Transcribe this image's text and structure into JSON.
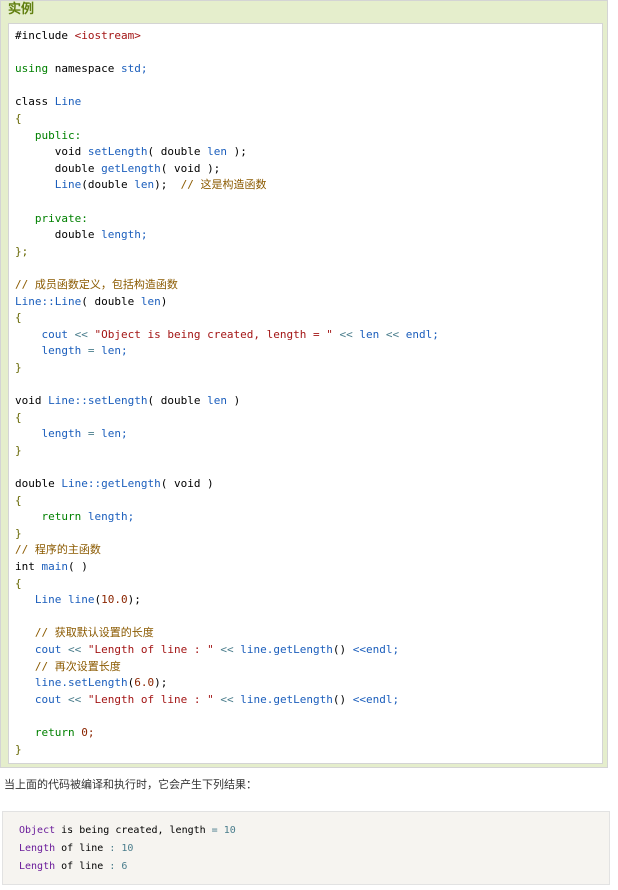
{
  "example": {
    "title": "实例",
    "code_lines": [
      [
        [
          "#include ",
          "c-kw"
        ],
        [
          "<iostream>",
          "c-red"
        ]
      ],
      [],
      [
        [
          "using ",
          "c-green"
        ],
        [
          "namespace ",
          "c-kw"
        ],
        [
          "std;",
          "c-blue"
        ]
      ],
      [],
      [
        [
          "class ",
          "c-kw"
        ],
        [
          "Line",
          "c-blue"
        ]
      ],
      [
        [
          "{",
          "c-pun"
        ]
      ],
      [
        [
          "   ",
          ""
        ],
        [
          "public:",
          "c-green"
        ]
      ],
      [
        [
          "      void ",
          "c-kw"
        ],
        [
          "setLength",
          "c-blue"
        ],
        [
          "( double ",
          "c-kw"
        ],
        [
          "len",
          "c-blue"
        ],
        [
          " );",
          "c-kw"
        ]
      ],
      [
        [
          "      double ",
          "c-kw"
        ],
        [
          "getLength",
          "c-blue"
        ],
        [
          "( void ",
          "c-kw"
        ],
        [
          ");",
          "c-kw"
        ]
      ],
      [
        [
          "      ",
          ""
        ],
        [
          "Line",
          "c-blue"
        ],
        [
          "(double ",
          "c-kw"
        ],
        [
          "len",
          "c-blue"
        ],
        [
          ");  ",
          "c-kw"
        ],
        [
          "// 这是构造函数",
          "c-com"
        ]
      ],
      [],
      [
        [
          "   ",
          ""
        ],
        [
          "private:",
          "c-green"
        ]
      ],
      [
        [
          "      double ",
          "c-kw"
        ],
        [
          "length;",
          "c-blue"
        ]
      ],
      [
        [
          "};",
          "c-pun"
        ]
      ],
      [],
      [
        [
          "// 成员函数定义，包括构造函数",
          "c-com"
        ]
      ],
      [
        [
          "Line::Line",
          "c-blue"
        ],
        [
          "( double ",
          "c-kw"
        ],
        [
          "len",
          "c-blue"
        ],
        [
          ")",
          "c-kw"
        ]
      ],
      [
        [
          "{",
          "c-pun"
        ]
      ],
      [
        [
          "    cout ",
          "c-blue"
        ],
        [
          "<< ",
          "c-teal"
        ],
        [
          "\"Object is being created, length = \"",
          "c-red"
        ],
        [
          " << ",
          "c-teal"
        ],
        [
          "len ",
          "c-blue"
        ],
        [
          "<< ",
          "c-teal"
        ],
        [
          "endl;",
          "c-blue"
        ]
      ],
      [
        [
          "    length ",
          "c-blue"
        ],
        [
          "= ",
          "c-teal"
        ],
        [
          "len;",
          "c-blue"
        ]
      ],
      [
        [
          "}",
          "c-pun"
        ]
      ],
      [],
      [
        [
          "void ",
          "c-kw"
        ],
        [
          "Line::setLength",
          "c-blue"
        ],
        [
          "( double ",
          "c-kw"
        ],
        [
          "len ",
          "c-blue"
        ],
        [
          ")",
          "c-kw"
        ]
      ],
      [
        [
          "{",
          "c-pun"
        ]
      ],
      [
        [
          "    length ",
          "c-blue"
        ],
        [
          "= ",
          "c-teal"
        ],
        [
          "len;",
          "c-blue"
        ]
      ],
      [
        [
          "}",
          "c-pun"
        ]
      ],
      [],
      [
        [
          "double ",
          "c-kw"
        ],
        [
          "Line::getLength",
          "c-blue"
        ],
        [
          "( void )",
          "c-kw"
        ]
      ],
      [
        [
          "{",
          "c-pun"
        ]
      ],
      [
        [
          "    return ",
          "c-green"
        ],
        [
          "length;",
          "c-blue"
        ]
      ],
      [
        [
          "}",
          "c-pun"
        ]
      ],
      [
        [
          "// 程序的主函数",
          "c-com"
        ]
      ],
      [
        [
          "int ",
          "c-kw"
        ],
        [
          "main",
          "c-blue"
        ],
        [
          "( )",
          "c-kw"
        ]
      ],
      [
        [
          "{",
          "c-pun"
        ]
      ],
      [
        [
          "   Line ",
          "c-blue"
        ],
        [
          "line",
          "c-blue"
        ],
        [
          "(",
          "c-kw"
        ],
        [
          "10.0",
          "c-num"
        ],
        [
          ");",
          "c-kw"
        ]
      ],
      [],
      [
        [
          "   ",
          ""
        ],
        [
          "// 获取默认设置的长度",
          "c-com"
        ]
      ],
      [
        [
          "   cout ",
          "c-blue"
        ],
        [
          "<< ",
          "c-teal"
        ],
        [
          "\"Length of line : \"",
          "c-red"
        ],
        [
          " << ",
          "c-teal"
        ],
        [
          "line.getLength",
          "c-blue"
        ],
        [
          "() ",
          "c-kw"
        ],
        [
          "<<endl;",
          "c-blue"
        ]
      ],
      [
        [
          "   ",
          ""
        ],
        [
          "// 再次设置长度",
          "c-com"
        ]
      ],
      [
        [
          "   line.setLength",
          "c-blue"
        ],
        [
          "(",
          "c-kw"
        ],
        [
          "6.0",
          "c-num"
        ],
        [
          ");",
          "c-kw"
        ]
      ],
      [
        [
          "   cout ",
          "c-blue"
        ],
        [
          "<< ",
          "c-teal"
        ],
        [
          "\"Length of line : \"",
          "c-red"
        ],
        [
          " << ",
          "c-teal"
        ],
        [
          "line.getLength",
          "c-blue"
        ],
        [
          "() ",
          "c-kw"
        ],
        [
          "<<endl;",
          "c-blue"
        ]
      ],
      [],
      [
        [
          "   return ",
          "c-green"
        ],
        [
          "0;",
          "c-num"
        ]
      ],
      [
        [
          "}",
          "c-pun"
        ]
      ]
    ]
  },
  "description": "当上面的代码被编译和执行时，它会产生下列结果：",
  "output": {
    "lines": [
      [
        [
          "Object ",
          "c-purple"
        ],
        [
          "is being created, length ",
          "c-kw"
        ],
        [
          "= ",
          "c-teal"
        ],
        [
          "10",
          "c-teal"
        ]
      ],
      [
        [
          "Length ",
          "c-purple"
        ],
        [
          "of line ",
          "c-kw"
        ],
        [
          ": ",
          "c-teal"
        ],
        [
          "10",
          "c-teal"
        ]
      ],
      [
        [
          "Length ",
          "c-purple"
        ],
        [
          "of line ",
          "c-kw"
        ],
        [
          ": ",
          "c-teal"
        ],
        [
          "6",
          "c-teal"
        ]
      ]
    ]
  },
  "colors": {
    "example_bg": "#e5eecc",
    "title": "#617f10",
    "keyword_green": "#008000",
    "identifier_blue": "#1b5ebc",
    "string_red": "#a31515",
    "comment": "#8b5a00",
    "output_bg": "#f6f4f0"
  }
}
